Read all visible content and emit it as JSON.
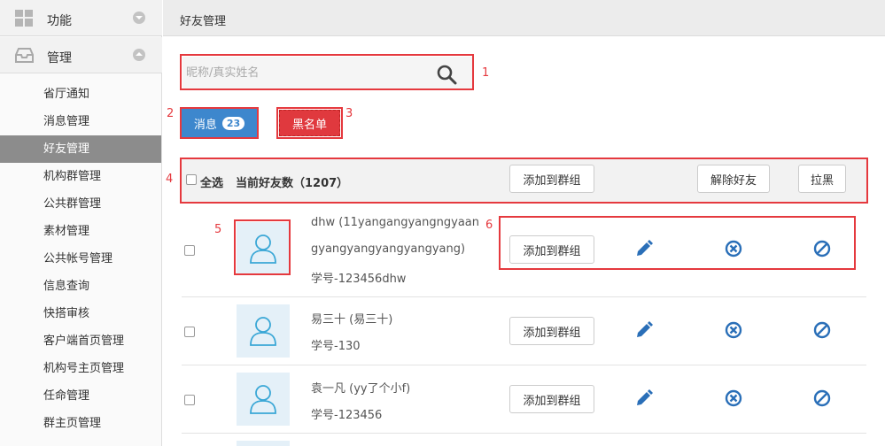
{
  "sidebar": {
    "sections": [
      {
        "label": "功能",
        "icon": "grid-icon",
        "expanded": false
      },
      {
        "label": "管理",
        "icon": "inbox-icon",
        "expanded": true
      }
    ],
    "items": [
      "省厅通知",
      "消息管理",
      "好友管理",
      "机构群管理",
      "公共群管理",
      "素材管理",
      "公共帐号管理",
      "信息查询",
      "快搭审核",
      "客户端首页管理",
      "机构号主页管理",
      "任命管理",
      "群主页管理"
    ],
    "active_index": 2
  },
  "page": {
    "title": "好友管理"
  },
  "search": {
    "placeholder": "昵称/真实姓名",
    "value": ""
  },
  "buttons": {
    "messages_label": "消息",
    "messages_count": "23",
    "blacklist_label": "黑名单"
  },
  "toolbar": {
    "select_all": "全选",
    "friend_count_label": "当前好友数（1207）",
    "add_to_group": "添加到群组",
    "remove_friend": "解除好友",
    "block": "拉黑"
  },
  "annotations": [
    "1",
    "2",
    "3",
    "4",
    "5",
    "6"
  ],
  "friends": [
    {
      "name_line1": "dhw (11yangangyangngyaan",
      "name_line2": "gyangyangyangyangyang)",
      "student_id": "学号-123456dhw",
      "add_label": "添加到群组"
    },
    {
      "name_line1": "易三十 (易三十)",
      "student_id": "学号-130",
      "add_label": "添加到群组"
    },
    {
      "name_line1": "袁一凡 (yy了个小f)",
      "student_id": "学号-123456",
      "add_label": "添加到群组"
    }
  ],
  "colors": {
    "accent_blue": "#3d87cd",
    "danger_red": "#e0393e",
    "annotation_red": "#e5393e",
    "icon_blue": "#2a6fb8"
  }
}
